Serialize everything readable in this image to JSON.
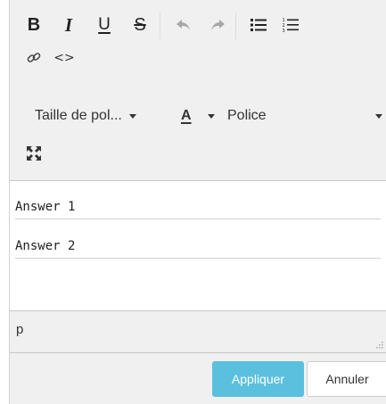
{
  "toolbar": {
    "bold_label": "B",
    "italic_label": "I",
    "underline_label": "U",
    "strike_label": "S",
    "undo_icon": "undo-icon",
    "redo_icon": "redo-icon",
    "bullet_list_icon": "bullet-list-icon",
    "numbered_list_icon": "numbered-list-icon",
    "link_icon": "link-icon",
    "code_label": "<>",
    "font_size_label": "Taille de pol...",
    "text_color_label": "A",
    "font_family_label": "Police",
    "fullscreen_icon": "fullscreen-icon"
  },
  "content": {
    "lines": [
      "Answer 1",
      "Answer 2"
    ]
  },
  "statusbar": {
    "path": "p"
  },
  "footer": {
    "apply_label": "Appliquer",
    "cancel_label": "Annuler"
  },
  "colors": {
    "toolbar_bg": "#f0f0f0",
    "apply_bg": "#5bc0de",
    "color_underline": "#000000"
  }
}
